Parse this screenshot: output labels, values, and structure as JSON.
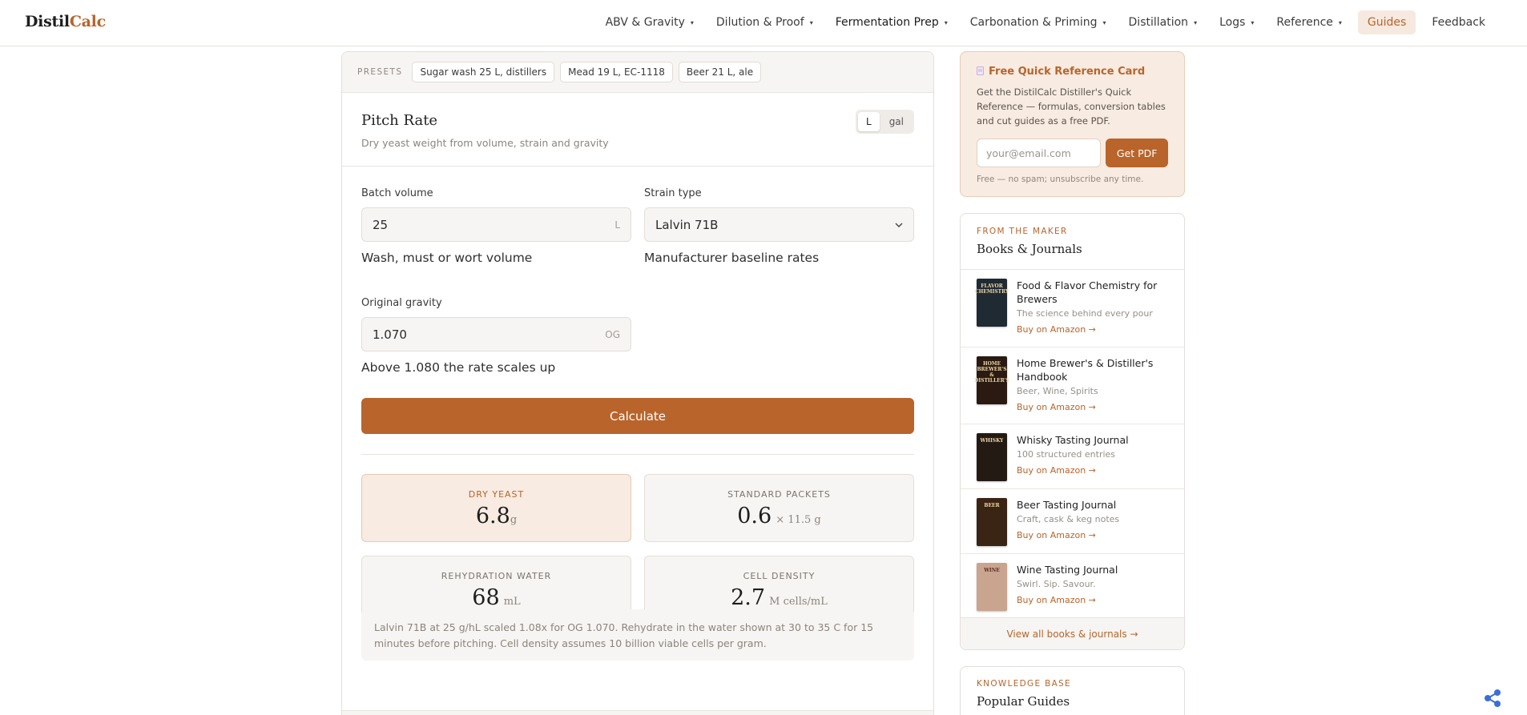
{
  "brand": {
    "name_main": "Distil",
    "name_accent": "Calc"
  },
  "nav": [
    {
      "label": "ABV & Gravity",
      "caret": "▾"
    },
    {
      "label": "Dilution & Proof",
      "caret": "▾"
    },
    {
      "label": "Fermentation Prep",
      "caret": "▾"
    },
    {
      "label": "Carbonation & Priming",
      "caret": "▾"
    },
    {
      "label": "Distillation",
      "caret": "▾"
    },
    {
      "label": "Logs",
      "caret": "▾"
    },
    {
      "label": "Reference",
      "caret": "▾"
    },
    {
      "label": "Guides"
    },
    {
      "label": "Feedback"
    }
  ],
  "presets": {
    "label": "PRESETS",
    "items": [
      "Sugar wash 25 L, distillers",
      "Mead 19 L, EC-1118",
      "Beer 21 L, ale"
    ]
  },
  "calculator": {
    "title": "Pitch Rate",
    "subtitle": "Dry yeast weight from volume, strain and gravity",
    "units": [
      "L",
      "gal"
    ],
    "selected_unit": "L",
    "fields": {
      "batch_volume": {
        "label": "Batch volume",
        "value": "25",
        "unit": "L",
        "help": "Wash, must or wort volume"
      },
      "strain_type": {
        "label": "Strain type",
        "value": "Lalvin 71B",
        "help": "Manufacturer baseline rates"
      },
      "original_gravity": {
        "label": "Original gravity",
        "value": "1.070",
        "unit": "OG",
        "help": "Above 1.080 the rate scales up"
      }
    },
    "calculate_label": "Calculate",
    "results": {
      "dry_yeast": {
        "label": "DRY YEAST",
        "value": "6.8",
        "unit": "g"
      },
      "standard_packets": {
        "label": "STANDARD PACKETS",
        "value": "0.6",
        "unit": "× 11.5 g"
      },
      "rehydration_water": {
        "label": "REHYDRATION WATER",
        "value": "68",
        "unit": "mL"
      },
      "cell_density": {
        "label": "CELL DENSITY",
        "value": "2.7",
        "unit": "M cells/mL"
      }
    },
    "note": "Lalvin 71B at 25 g/hL scaled 1.08x for OG 1.070. Rehydrate in the water shown at 30 to 35 C for 15 minutes before pitching. Cell density assumes 10 billion viable cells per gram."
  },
  "promo": {
    "title": "Free Quick Reference Card",
    "text": "Get the DistilCalc Distiller's Quick Reference — formulas, conversion tables and cut guides as a free PDF.",
    "email_placeholder": "your@email.com",
    "button": "Get PDF",
    "fine_print": "Free — no spam; unsubscribe any time."
  },
  "books": {
    "eyebrow": "FROM THE MAKER",
    "title": "Books & Journals",
    "items": [
      {
        "title": "Food & Flavor Chemistry for Brewers",
        "desc": "The science behind every pour",
        "link": "Buy on Amazon →",
        "cover_text": "FLAVOR CHEMISTRY",
        "cover_color": "#1f2a33"
      },
      {
        "title": "Home Brewer's & Distiller's Handbook",
        "desc": "Beer, Wine, Spirits",
        "link": "Buy on Amazon →",
        "cover_text": "HOME BREWER'S & DISTILLER'S",
        "cover_color": "#2a1a12"
      },
      {
        "title": "Whisky Tasting Journal",
        "desc": "100 structured entries",
        "link": "Buy on Amazon →",
        "cover_text": "WHISKY",
        "cover_color": "#241a14"
      },
      {
        "title": "Beer Tasting Journal",
        "desc": "Craft, cask & keg notes",
        "link": "Buy on Amazon →",
        "cover_text": "BEER",
        "cover_color": "#3a2414"
      },
      {
        "title": "Wine Tasting Journal",
        "desc": "Swirl. Sip. Savour.",
        "link": "Buy on Amazon →",
        "cover_text": "WINE",
        "cover_color": "#c9a48f"
      }
    ],
    "view_all": "View all books & journals →"
  },
  "knowledge": {
    "eyebrow": "KNOWLEDGE BASE",
    "title": "Popular Guides"
  },
  "colors": {
    "accent": "#b9642a",
    "accent_soft": "#f8ebe1",
    "panel": "#f7f5f3"
  }
}
